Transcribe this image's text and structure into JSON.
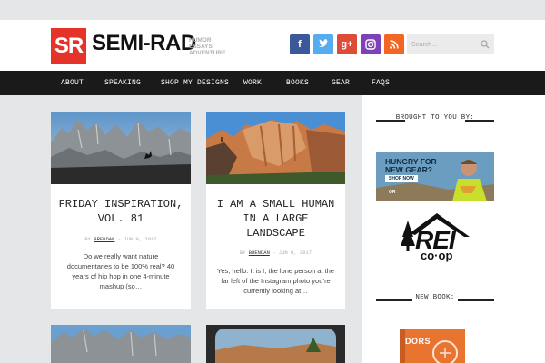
{
  "header": {
    "logo_mark": "SR",
    "logo_text": "SEMI-RAD",
    "tagline": [
      "HUMOR",
      "ESSAYS",
      "ADVENTURE"
    ],
    "search_placeholder": "Search...",
    "social": [
      {
        "name": "facebook-icon",
        "glyph": "f"
      },
      {
        "name": "twitter-icon",
        "glyph": "t"
      },
      {
        "name": "google-plus-icon",
        "glyph": "g+"
      },
      {
        "name": "instagram-icon",
        "glyph": "◘"
      },
      {
        "name": "rss-icon",
        "glyph": "◔"
      }
    ]
  },
  "nav": {
    "items": [
      "ABOUT",
      "SPEAKING",
      "SHOP MY DESIGNS",
      "WORK",
      "BOOKS",
      "GEAR",
      "FAQS"
    ]
  },
  "posts": [
    {
      "title": "FRIDAY INSPIRATION, VOL. 81",
      "by": "BY",
      "author": "BRENDAN",
      "date": "- JUN 9, 2017",
      "excerpt": "Do we really want nature documentaries to be 100% real? 40 years of hip hop in one 4-minute mashup (so…"
    },
    {
      "title": "I AM A SMALL HUMAN IN A LARGE LANDSCAPE",
      "by": "BY",
      "author": "BRENDAN",
      "date": "- JUN 8, 2017",
      "excerpt": "Yes, hello. It is I, the lone person at the far left of the Instagram photo you’re currently looking at…"
    }
  ],
  "sidebar": {
    "brought_by": "BROUGHT TO YOU BY:",
    "ad": {
      "headline": "HUNGRY FOR NEW GEAR?",
      "button": "SHOP NOW",
      "brand": "OR"
    },
    "rei": {
      "main": "REI",
      "sub": "co·op"
    },
    "new_book": "NEW BOOK:",
    "book_text": "DORS"
  },
  "colors": {
    "brand_red": "#e5332a",
    "nav_bg": "#1a1a1a",
    "page_bg": "#e5e6e8"
  }
}
